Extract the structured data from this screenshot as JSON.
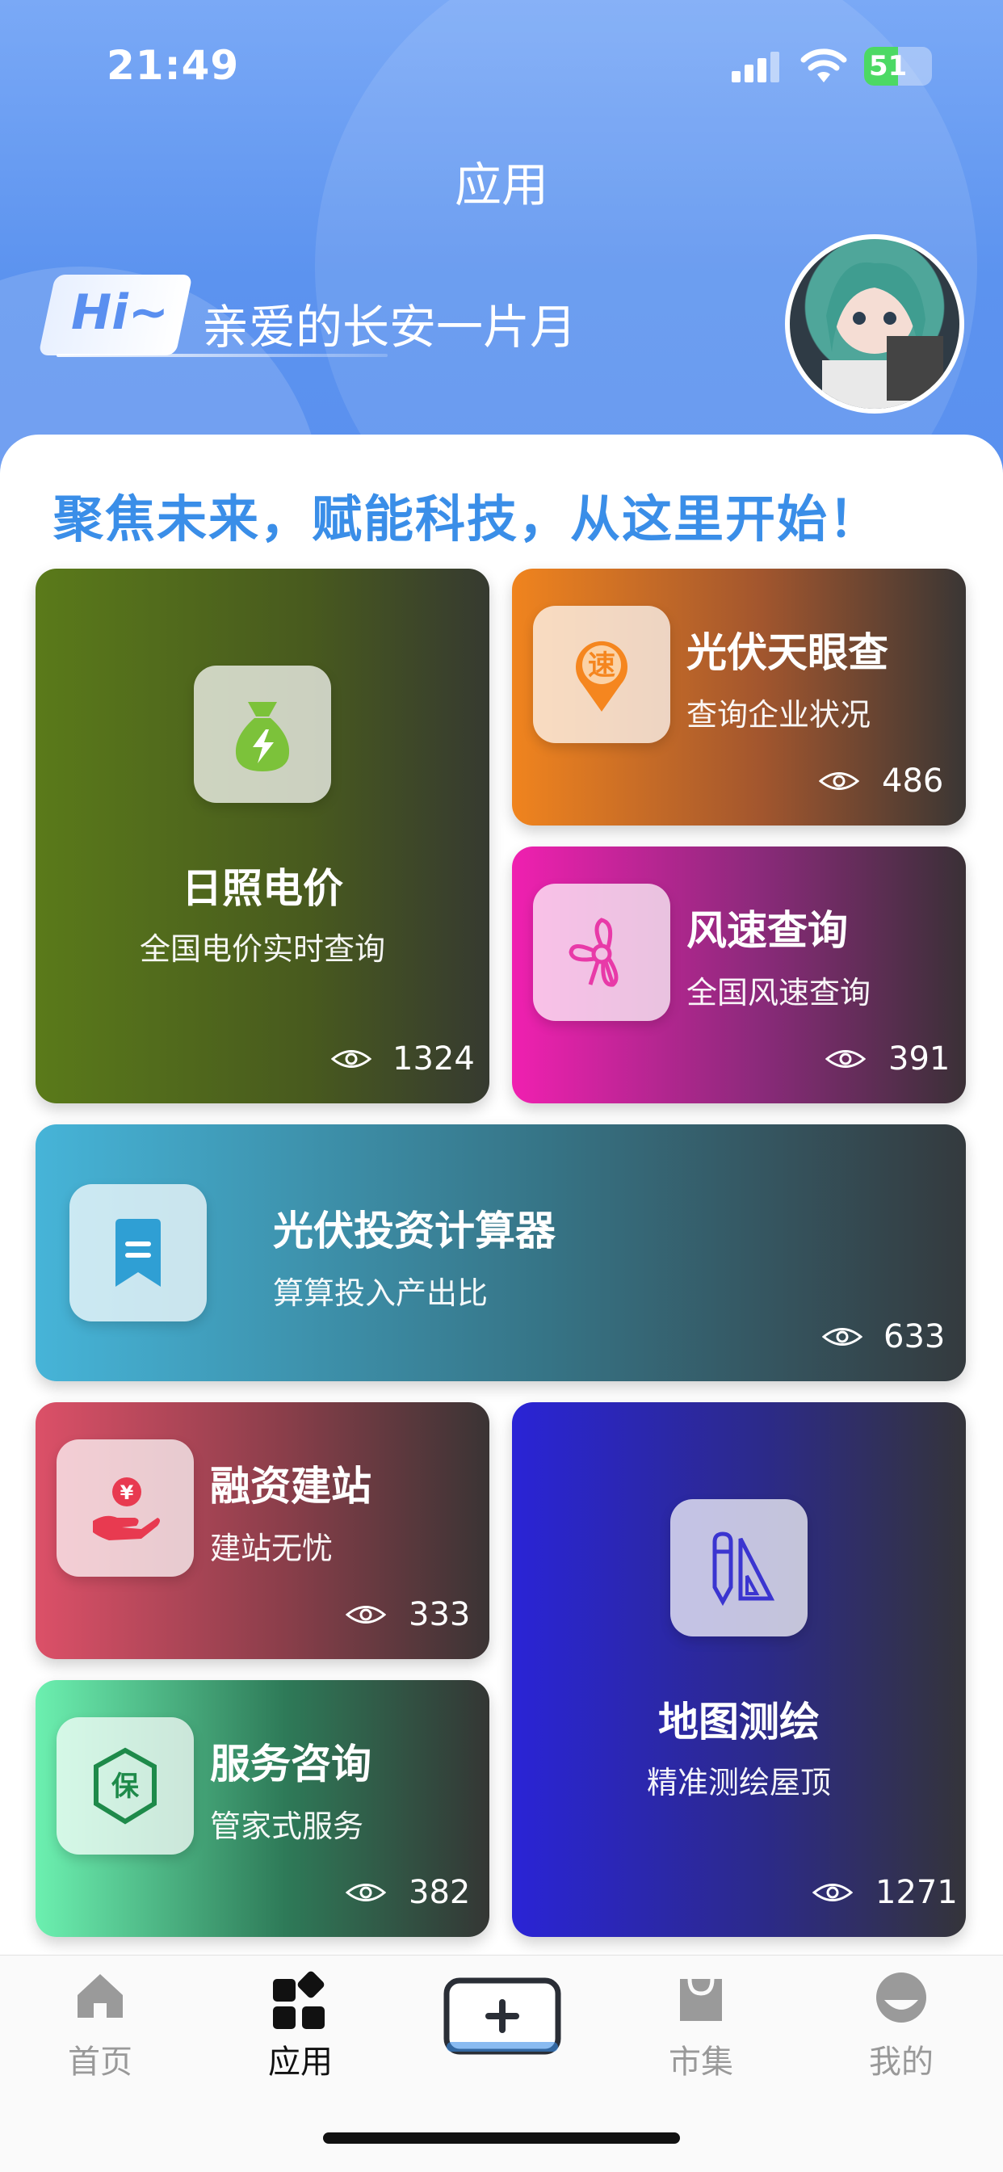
{
  "status": {
    "time": "21:49",
    "battery": "51"
  },
  "header": {
    "title": "应用",
    "hi": "Hi~",
    "greeting": "亲爱的长安一片月"
  },
  "slogan": "聚焦未来，赋能科技，从这里开始！",
  "cards": {
    "price": {
      "title": "日照电价",
      "subtitle": "全国电价实时查询",
      "views": "1324",
      "icon": "money-bag-icon"
    },
    "pv": {
      "title": "光伏天眼查",
      "subtitle": "查询企业状况",
      "views": "486",
      "icon": "speed-pin-icon"
    },
    "wind": {
      "title": "风速查询",
      "subtitle": "全国风速查询",
      "views": "391",
      "icon": "fan-icon"
    },
    "invest": {
      "title": "光伏投资计算器",
      "subtitle": "算算投入产出比",
      "views": "633",
      "icon": "bookmark-icon"
    },
    "finance": {
      "title": "融资建站",
      "subtitle": "建站无忧",
      "views": "333",
      "icon": "yen-hand-icon"
    },
    "map": {
      "title": "地图测绘",
      "subtitle": "精准测绘屋顶",
      "views": "1271",
      "icon": "pencil-ruler-icon"
    },
    "service": {
      "title": "服务咨询",
      "subtitle": "管家式服务",
      "views": "382",
      "icon": "shield-bao-icon"
    }
  },
  "tabs": [
    {
      "label": "首页",
      "icon": "home-icon"
    },
    {
      "label": "应用",
      "icon": "apps-icon"
    },
    {
      "label": "",
      "icon": "plus-icon"
    },
    {
      "label": "市集",
      "icon": "bag-icon"
    },
    {
      "label": "我的",
      "icon": "profile-icon"
    }
  ],
  "colors": {
    "brand_blue": "#5c93ef",
    "slogan": "#3a8ee8",
    "price_card": "#5a7a1a",
    "pv_card": "#f0841e",
    "wind_card": "#f020b0",
    "invest_card": "#46b4d8",
    "finance_card": "#dc5068",
    "map_card": "#2a24d6",
    "service_card": "#6cf0b0"
  }
}
